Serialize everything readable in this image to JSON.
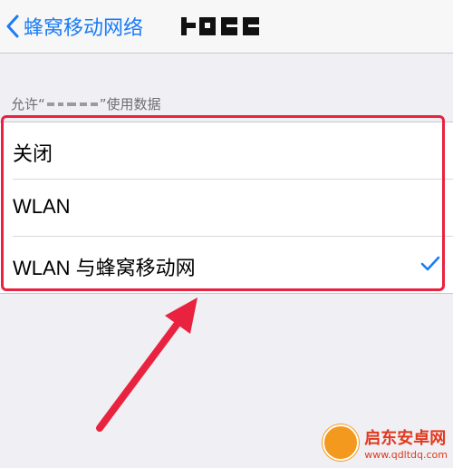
{
  "navbar": {
    "back_label": "蜂窝移动网络"
  },
  "section": {
    "label_prefix": "允许“",
    "label_suffix": "”使用数据"
  },
  "options": [
    {
      "label": "关闭",
      "selected": false
    },
    {
      "label": "WLAN",
      "selected": false
    },
    {
      "label": "WLAN 与蜂窝移动网",
      "selected": true
    }
  ],
  "colors": {
    "accent": "#1a7cf5",
    "annotation": "#e8223f"
  },
  "icons": {
    "back": "chevron-left-icon",
    "check": "checkmark-icon",
    "arrow": "annotation-arrow"
  },
  "watermark": {
    "name": "启东安卓网",
    "url": "www.qdltdq.com"
  }
}
